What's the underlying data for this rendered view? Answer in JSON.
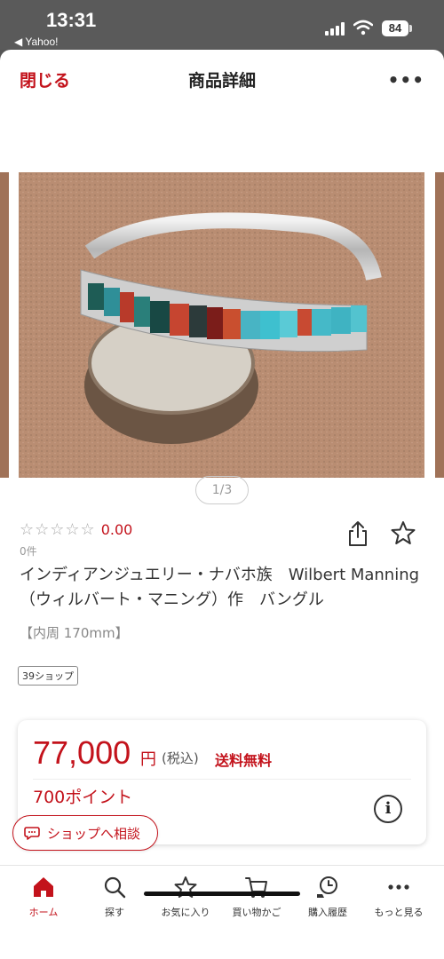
{
  "status": {
    "time": "13:31",
    "back_label": "◀ Yahoo!",
    "battery": "84"
  },
  "nav": {
    "close": "閉じる",
    "title": "商品詳細",
    "more": "•••"
  },
  "carousel": {
    "pager": "1/3"
  },
  "rating": {
    "stars": "☆☆☆☆☆",
    "score": "0.00",
    "reviews": "0件"
  },
  "product": {
    "title": "インディアンジュエリー・ナバホ族　Wilbert Manning（ウィルバート・マニング）作　バングル",
    "size": "【内周 170mm】",
    "shop_badge": "39ショップ"
  },
  "price": {
    "amount": "77,000",
    "yen": "円",
    "tax": "(税込)",
    "shipping": "送料無料",
    "points": "700ポイント",
    "info": "i"
  },
  "consult": {
    "label": "ショップへ相談"
  },
  "tabs": [
    {
      "label": "ホーム",
      "icon": "home-icon"
    },
    {
      "label": "探す",
      "icon": "search-icon"
    },
    {
      "label": "お気に入り",
      "icon": "star-icon"
    },
    {
      "label": "買い物かご",
      "icon": "cart-icon"
    },
    {
      "label": "購入履歴",
      "icon": "history-icon"
    },
    {
      "label": "もっと見る",
      "icon": "more-icon"
    }
  ],
  "colors": {
    "accent": "#c3121b"
  }
}
